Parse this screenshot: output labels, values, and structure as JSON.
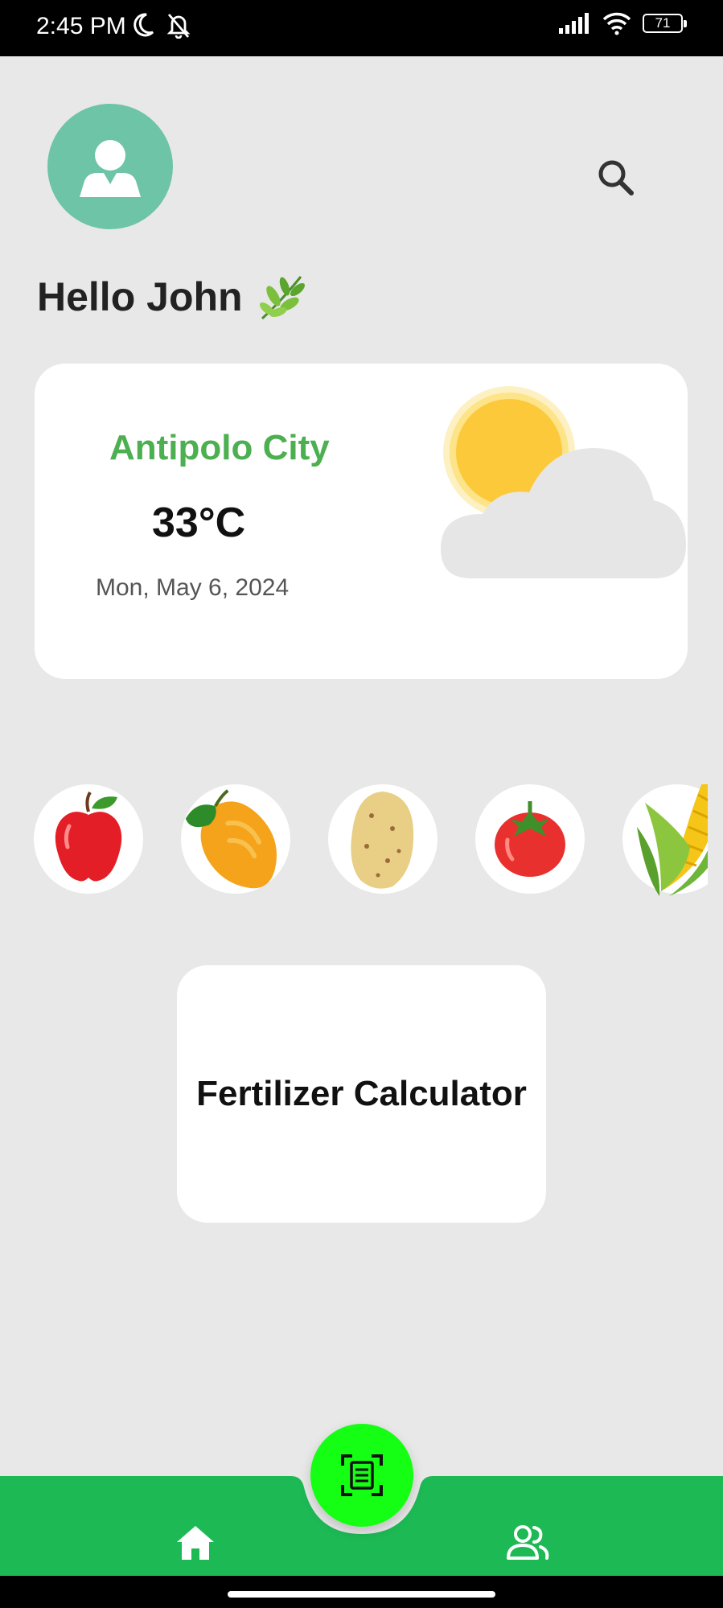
{
  "status_bar": {
    "time": "2:45 PM",
    "battery": "71"
  },
  "header": {
    "greeting": "Hello John"
  },
  "weather": {
    "city": "Antipolo City",
    "temperature": "33°C",
    "date": "Mon, May 6, 2024",
    "condition_icon": "partly-cloudy-icon"
  },
  "produce": [
    {
      "name": "apple-icon"
    },
    {
      "name": "mango-icon"
    },
    {
      "name": "potato-icon"
    },
    {
      "name": "tomato-icon"
    },
    {
      "name": "corn-icon"
    }
  ],
  "tools": {
    "fertilizer_calculator_label": "Fertilizer Calculator"
  },
  "bottom_nav": {
    "items": [
      "home-icon",
      "scan-icon",
      "users-icon"
    ]
  },
  "colors": {
    "accent_green": "#1db954",
    "fab_green": "#14ff14",
    "city_green": "#4caf50",
    "avatar_teal": "#6dc4a6",
    "background": "#e8e8e8"
  }
}
